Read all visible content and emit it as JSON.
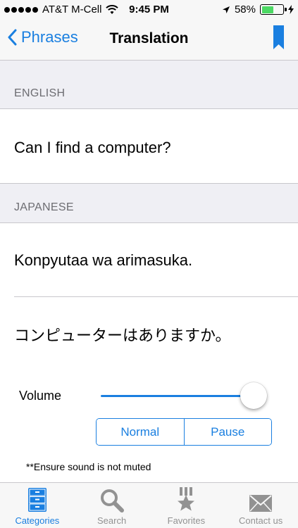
{
  "status_bar": {
    "carrier": "AT&T M-Cell",
    "time": "9:45 PM",
    "battery": "58%",
    "battery_level": 0.58
  },
  "nav": {
    "back_label": "Phrases",
    "title": "Translation"
  },
  "english": {
    "header": "ENGLISH",
    "text": "Can I find a computer?"
  },
  "japanese": {
    "header": "JAPANESE",
    "romaji": "Konpyutaa wa arimasuka.",
    "native": "コンピューターはありますか。"
  },
  "audio": {
    "volume_label": "Volume",
    "volume_level": 0.95,
    "normal_label": "Normal",
    "pause_label": "Pause",
    "note": "**Ensure sound is not muted"
  },
  "tabs": [
    {
      "label": "Categories",
      "icon": "cabinet-icon",
      "active": true
    },
    {
      "label": "Search",
      "icon": "search-icon",
      "active": false
    },
    {
      "label": "Favorites",
      "icon": "star-medal-icon",
      "active": false
    },
    {
      "label": "Contact us",
      "icon": "envelope-icon",
      "active": false
    }
  ],
  "colors": {
    "accent": "#1a7fe0",
    "battery_fill": "#4cd964",
    "inactive_tab": "#929292"
  }
}
